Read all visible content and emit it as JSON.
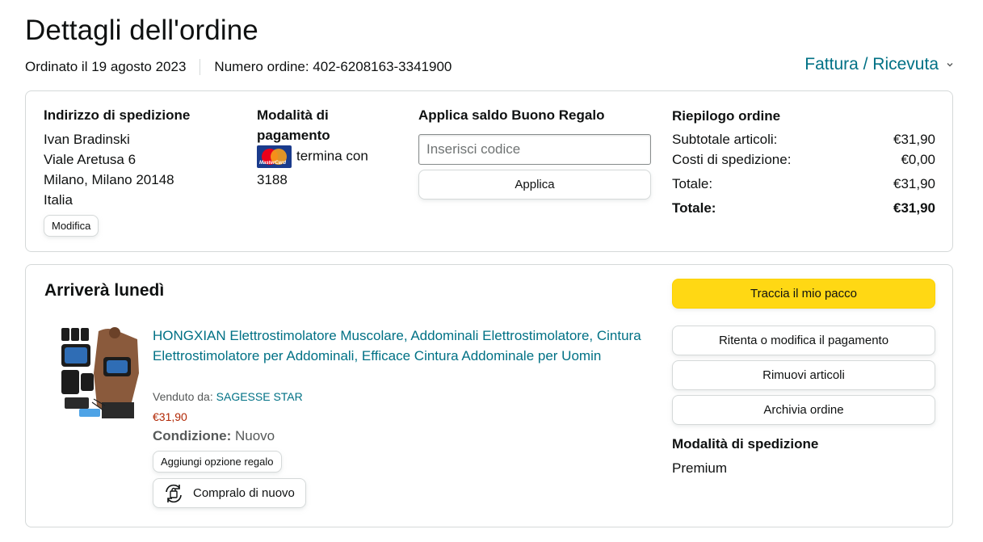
{
  "page": {
    "title": "Dettagli dell'ordine",
    "ordered_on": "Ordinato il 19 agosto 2023",
    "order_number": "Numero ordine: 402-6208163-3341900",
    "invoice_link": "Fattura / Ricevuta"
  },
  "shipping_address": {
    "heading": "Indirizzo di spedizione",
    "name": "Ivan Bradinski",
    "street": "Viale Aretusa 6",
    "city": "Milano, Milano 20148",
    "country": "Italia",
    "edit_label": "Modifica"
  },
  "payment": {
    "heading_line1": "Modalità di",
    "heading_line2": "pagamento",
    "card_brand": "MasterCard",
    "ending_text": "termina con",
    "last_digits": "3188"
  },
  "gift_card": {
    "heading": "Applica saldo Buono Regalo",
    "placeholder": "Inserisci codice",
    "apply_label": "Applica"
  },
  "summary": {
    "heading": "Riepilogo ordine",
    "rows": [
      {
        "label": "Subtotale articoli:",
        "value": "€31,90"
      },
      {
        "label": "Costi di spedizione:",
        "value": "€0,00"
      },
      {
        "label": "Totale:",
        "value": "€31,90"
      }
    ],
    "grand_total_label": "Totale:",
    "grand_total_value": "€31,90"
  },
  "shipment": {
    "status": "Arriverà lunedì",
    "product_title": "HONGXIAN Elettrostimolatore Muscolare, Addominali Elettrostimolatore, Cintura Elettrostimolatore per Addominali, Efficace Cintura Addominale per Uomin",
    "sold_by_label": "Venduto da:",
    "seller": "SAGESSE STAR",
    "price": "€31,90",
    "condition_label": "Condizione:",
    "condition_value": "Nuovo",
    "gift_option_label": "Aggiungi opzione regalo",
    "buy_again_label": "Compralo di nuovo"
  },
  "actions": {
    "track": "Traccia il mio pacco",
    "retry_payment": "Ritenta o modifica il pagamento",
    "remove_items": "Rimuovi articoli",
    "archive": "Archivia ordine",
    "shipping_method_heading": "Modalità di spedizione",
    "shipping_method_value": "Premium"
  },
  "colors": {
    "link": "#007185",
    "price": "#b12704",
    "primary_button": "#ffd814",
    "border": "#d5d9d9"
  }
}
